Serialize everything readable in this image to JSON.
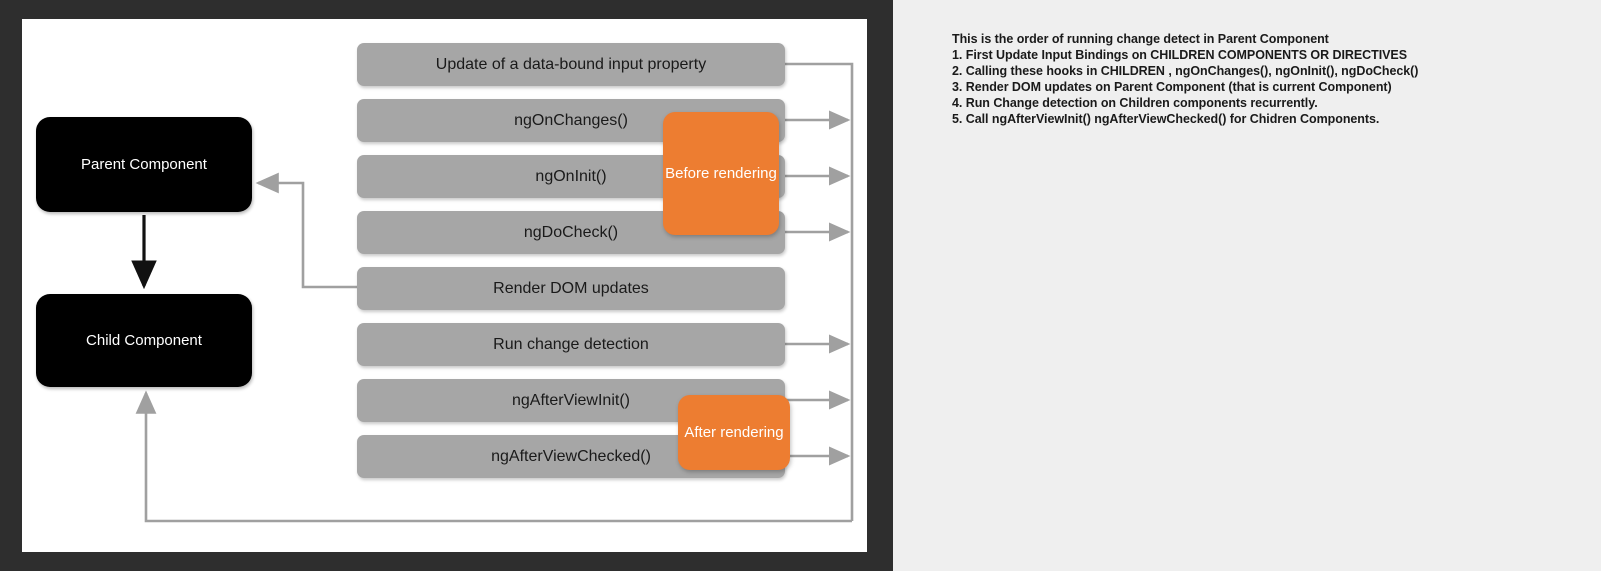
{
  "slide": {
    "components": [
      {
        "id": "parent-component",
        "label": "Parent Component"
      },
      {
        "id": "child-component",
        "label": "Child Component"
      }
    ],
    "stages": [
      {
        "index": 1,
        "label": "Update of a data-bound input property"
      },
      {
        "index": 2,
        "label": "ngOnChanges()"
      },
      {
        "index": 3,
        "label": "ngOnInit()"
      },
      {
        "index": 4,
        "label": "ngDoCheck()"
      },
      {
        "index": 5,
        "label": "Render DOM updates"
      },
      {
        "index": 6,
        "label": "Run change detection"
      },
      {
        "index": 7,
        "label": "ngAfterViewInit()"
      },
      {
        "index": 8,
        "label": "ngAfterViewChecked()"
      }
    ],
    "phases": [
      {
        "id": "before",
        "label": "Before rendering"
      },
      {
        "id": "after",
        "label": "After rendering"
      }
    ]
  },
  "notes": {
    "lines": [
      "This is the order of running change detect in Parent Component",
      "1. First Update Input Bindings on CHILDREN COMPONENTS OR DIRECTIVES",
      "2. Calling these hooks in CHILDREN , ngOnChanges(), ngOnInit(), ngDoCheck()",
      "3. Render DOM updates on Parent Component (that is current Component)",
      "4. Run Change detection on Children components recurrently.",
      "5. Call ngAfterViewInit()  ngAfterViewChecked() for Chidren Components."
    ]
  },
  "colors": {
    "frame": "#2E2E2E",
    "canvas": "#FFFFFF",
    "notes_background": "#EFEFEF",
    "component_box": "#000000",
    "stage_bar": "#A6A6A6",
    "phase_callout": "#ED7D31",
    "connector": "#A0A0A0",
    "component_arrow": "#111111"
  }
}
